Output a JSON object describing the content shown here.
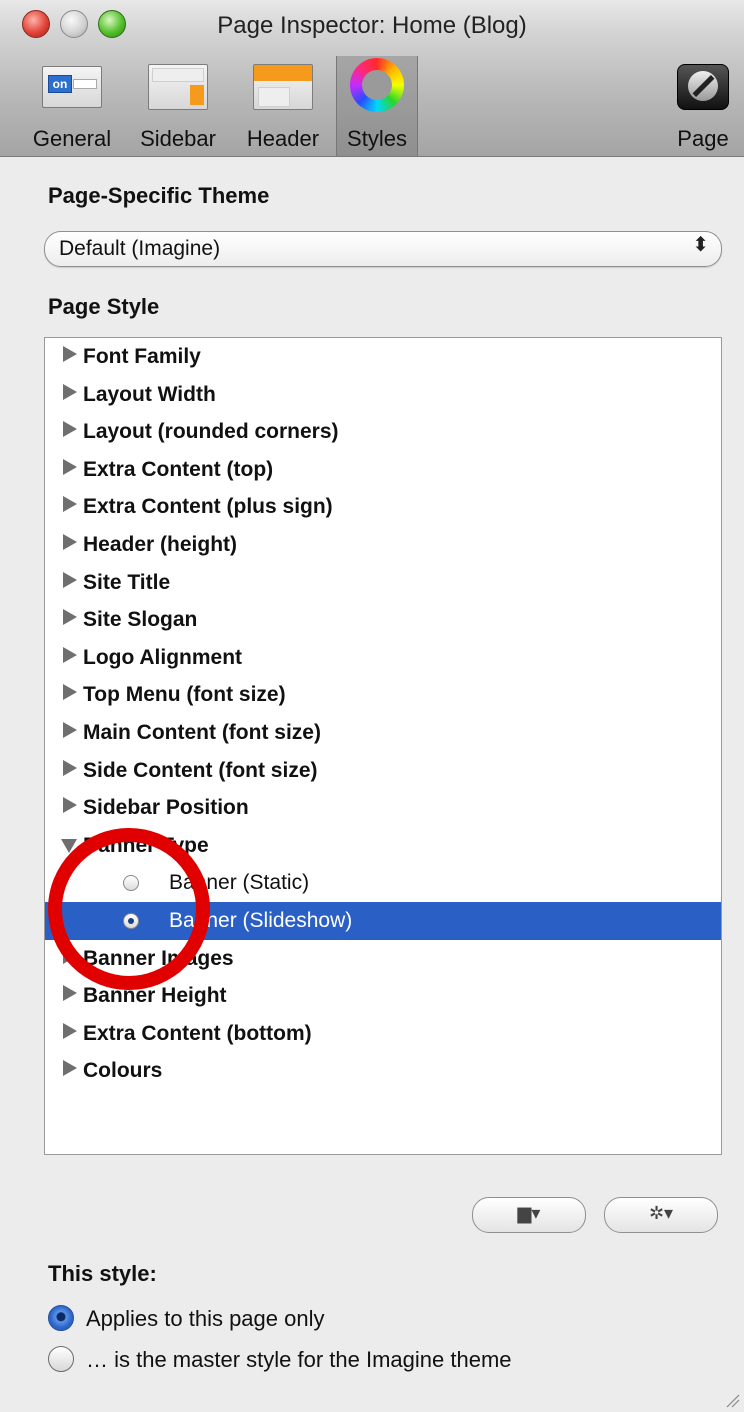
{
  "window": {
    "title": "Page Inspector: Home (Blog)"
  },
  "toolbar": {
    "general": "General",
    "sidebar": "Sidebar",
    "header": "Header",
    "styles": "Styles",
    "page": "Page",
    "general_icon_text": "on"
  },
  "theme": {
    "heading": "Page-Specific Theme",
    "selected": "Default (Imagine)",
    "arrows": "⬍"
  },
  "page_style": {
    "heading": "Page Style",
    "items": [
      "Font Family",
      "Layout Width",
      "Layout (rounded corners)",
      "Extra Content (top)",
      "Extra Content (plus sign)",
      "Header (height)",
      "Site Title",
      "Site Slogan",
      "Logo Alignment",
      "Top Menu (font size)",
      "Main Content (font size)",
      "Side Content (font size)",
      "Sidebar Position",
      "Banner Type",
      "Banner (Static)",
      "Banner (Slideshow)",
      "Banner Images",
      "Banner Height",
      "Extra Content (bottom)",
      "Colours"
    ]
  },
  "buttons": {
    "folder": "▆▾",
    "gear": "✲▾"
  },
  "this_style": {
    "heading": "This style:",
    "option1": "Applies to this page only",
    "option2": "… is the master style for the Imagine theme"
  },
  "colors": {
    "selection": "#2a5fc6",
    "annotation": "#e00000"
  }
}
